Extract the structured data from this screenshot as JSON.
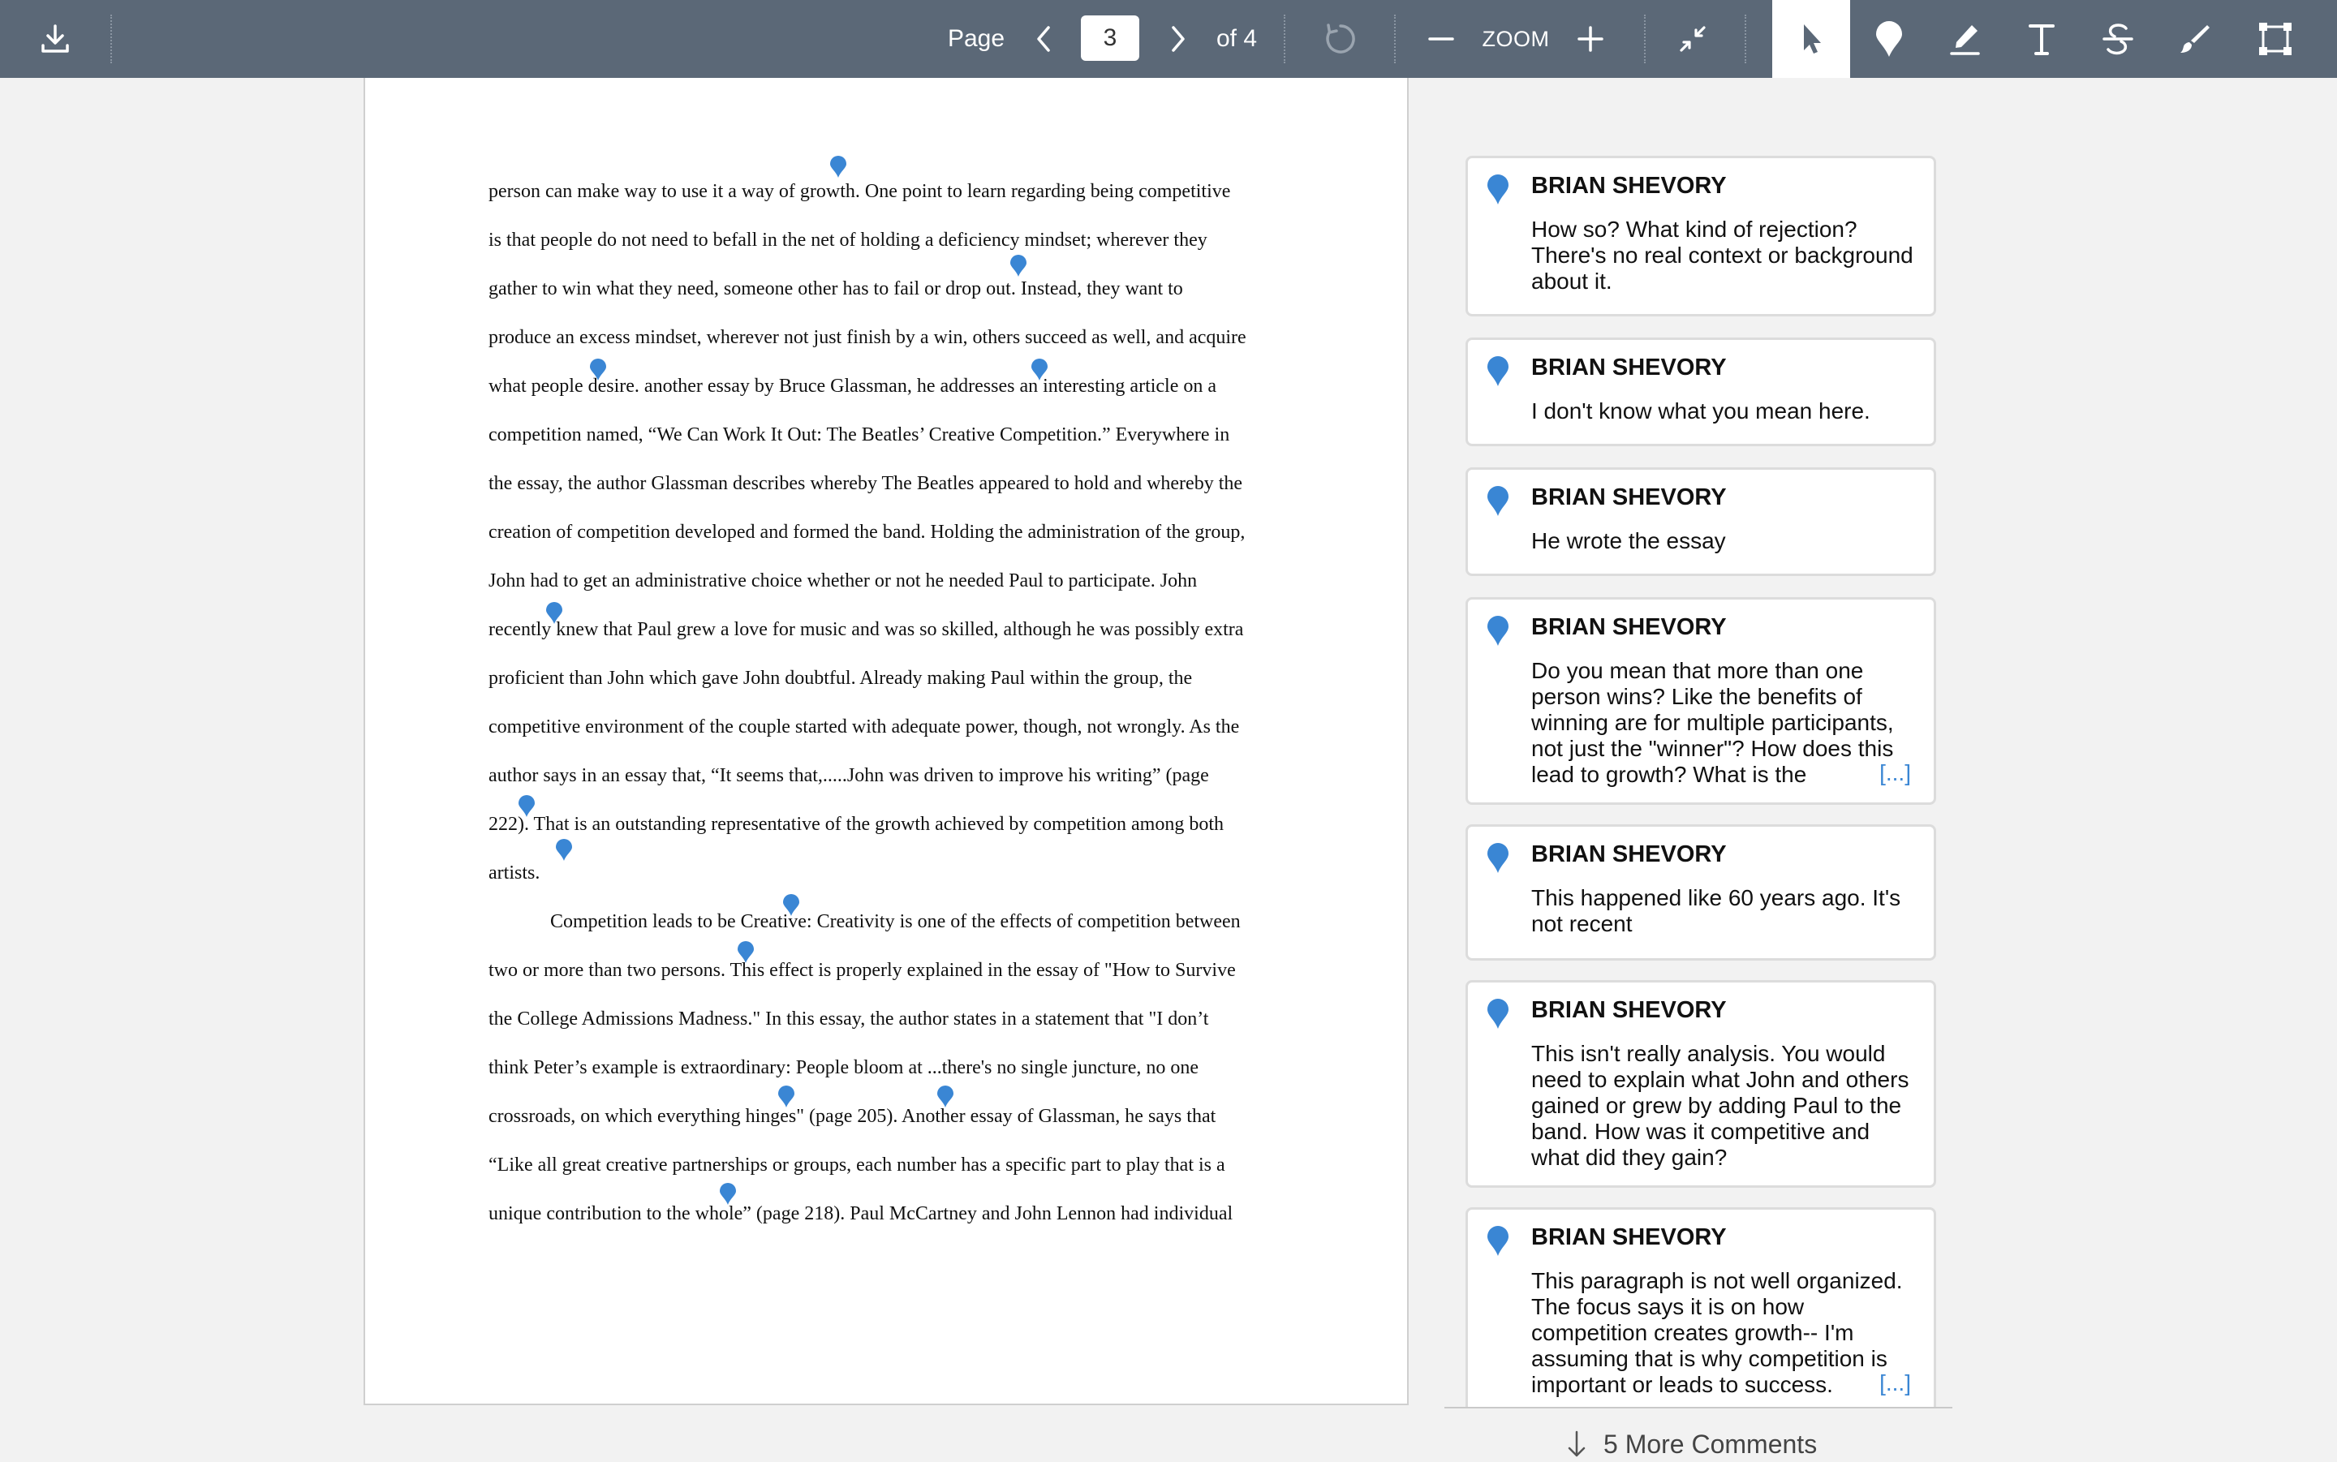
{
  "toolbar": {
    "page_label": "Page",
    "current_page": "3",
    "total_pages": "of 4",
    "zoom_label": "ZOOM",
    "icons": [
      "download-icon",
      "chevron-left-icon",
      "chevron-right-icon",
      "rotate-icon",
      "zoom-out-icon",
      "zoom-in-icon",
      "collapse-icon",
      "pointer-icon",
      "pin-icon",
      "highlighter-icon",
      "text-icon",
      "strikethrough-icon",
      "brush-icon",
      "area-select-icon"
    ],
    "active_tool": "pointer-icon",
    "accent_color": "#5b6877"
  },
  "document": {
    "lines": [
      "person can make way to use it a way of growth. One point to learn regarding being competitive",
      "is that people do not need to befall in the net of holding a deficiency mindset; wherever they",
      "gather to win what they need, someone other has to fail or drop out. Instead, they want to",
      "produce an excess mindset, wherever not just finish by a win, others succeed as well, and acquire",
      "what people desire. another essay by Bruce Glassman, he addresses an interesting article on a",
      "competition named, “We Can Work It Out: The Beatles’ Creative Competition.” Everywhere in",
      "the essay, the author Glassman describes whereby The Beatles appeared to hold and whereby the",
      "creation of competition developed and formed the band. Holding the administration of the group,",
      "John had to get an administrative choice whether or not he needed Paul to participate. John",
      "recently knew that Paul grew a love for music and was so skilled, although he was possibly extra",
      "proficient than John which gave John doubtful. Already making Paul within the group, the",
      "competitive environment of the couple started with adequate power, though, not wrongly. As the",
      "author says in an essay that, “It seems that,.....John was driven to improve his writing” (page",
      "222). That is an outstanding representative of the growth achieved by competition among both",
      "artists.",
      "Competition leads to be Creative: Creativity is one of the effects of competition between",
      "two or more than two persons. This effect is properly explained in the essay of  \"How to Survive",
      "the College Admissions Madness.\" In this essay, the author states in a statement that \"I don’t",
      "think Peter’s example is extraordinary: People bloom at ...there's no single juncture, no one",
      "crossroads, on which everything hinges\" (page 205). Another essay of Glassman, he says that",
      "“Like all great creative partnerships or groups, each number has a specific part to play that is a",
      "unique contribution to the whole” (page 218). Paul McCartney and John Lennon had individual"
    ],
    "pin_color": "#3a86d4"
  },
  "comments": [
    {
      "author": "BRIAN SHEVORY",
      "text": "How so? What kind of rejection? There's no real context or background about it.",
      "more": ""
    },
    {
      "author": "BRIAN SHEVORY",
      "text": "I don't know what you mean here.",
      "more": ""
    },
    {
      "author": "BRIAN SHEVORY",
      "text": "He wrote the essay",
      "more": ""
    },
    {
      "author": "BRIAN SHEVORY",
      "text": "Do you mean that more than one person wins? Like the benefits of winning are for multiple participants, not just the \"winner\"? How does this lead to growth? What is the",
      "more": "[...]"
    },
    {
      "author": "BRIAN SHEVORY",
      "text": "This happened like 60 years ago. It's not recent",
      "more": ""
    },
    {
      "author": "BRIAN SHEVORY",
      "text": "This isn't really analysis. You would need to explain what John and others gained or grew by adding Paul to the band. How was it competitive and what did they gain?",
      "more": ""
    },
    {
      "author": "BRIAN SHEVORY",
      "text": "This paragraph is not well organized. The focus says it is on how competition creates growth-- I'm assuming that is why competition is important or leads to success.",
      "more": "[...]"
    }
  ],
  "more_comments_label": "5 More Comments"
}
